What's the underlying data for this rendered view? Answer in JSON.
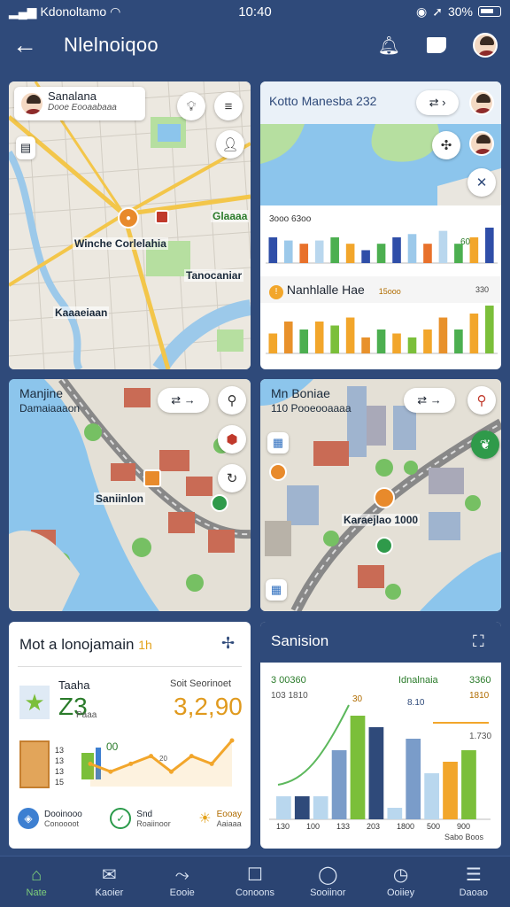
{
  "status": {
    "carrier": "Kdonoltamo",
    "time": "10:40",
    "battery": "30%"
  },
  "appbar": {
    "title": "Nlelnoiqoo"
  },
  "panel1": {
    "card_title": "Sanalana",
    "card_subtitle": "Dooe Eooaabaaa",
    "labels": {
      "center": "Winche Corlelahia",
      "east": "Tanocaniar",
      "southwest": "Kaaaeiaan",
      "northeast": "Glaaaa"
    }
  },
  "panel2": {
    "header": "Kotto Manesba 232",
    "chart1_title": "3ooo 63oo",
    "chart2_title": "Nanhlalle Hae",
    "chart2_badge": "15ooo",
    "chart2_value": "330",
    "chart1_label": "60",
    "chart_data": [
      {
        "type": "bar",
        "values": [
          8,
          7,
          6,
          7,
          8,
          6,
          4,
          6,
          8,
          9,
          6,
          10,
          6,
          8,
          11
        ]
      },
      {
        "type": "bar",
        "values": [
          5,
          8,
          6,
          8,
          7,
          9,
          4,
          6,
          5,
          4,
          6,
          9,
          6,
          10,
          12
        ]
      }
    ]
  },
  "panel3": {
    "title": "Manjine",
    "subtitle": "Damaiaaaon",
    "place": "Saniinlon"
  },
  "panel4": {
    "title": "Mn Boniae",
    "subtitle": "110 Pooeooaaaa",
    "place": "Karaejlao 1000"
  },
  "panel5": {
    "title": "Mot a lonojamain",
    "title_badge": "1h",
    "stat_label": "Taaha",
    "stat_sub": "Paaa",
    "stat_small": "Z3",
    "right_label": "Soit Seorinoet",
    "big_value": "3,2,90",
    "mini_value": "00",
    "chart_data": {
      "type": "line",
      "values": [
        6,
        5,
        6,
        7,
        5,
        7,
        6,
        9
      ]
    },
    "chart_labels": [
      "13",
      "13",
      "13",
      "15"
    ],
    "mid_label": "20",
    "footer": [
      {
        "label": "Dooinooo",
        "sub": "Conoooot"
      },
      {
        "label": "Snd",
        "sub": "Roaiinoor"
      },
      {
        "label": "Eooay",
        "sub": "Aaiaaa"
      }
    ]
  },
  "panel6": {
    "title": "Sanision",
    "left_top": "3 00360",
    "left_mid": "103 1810",
    "right_top": "Idnalnaia",
    "right_value": "3360",
    "right_mid": "1810",
    "bar_label": "30",
    "bar_label2": "8.10",
    "side_label": "1.730",
    "chart_data": {
      "type": "bar",
      "series": [
        {
          "values": [
            2,
            2,
            2,
            6,
            9,
            8,
            1,
            7,
            4,
            5,
            6
          ]
        }
      ]
    },
    "ticks": [
      "130",
      "100",
      "133",
      "203",
      "1800",
      "500",
      "900"
    ],
    "footer_right": "Sabo Boos"
  },
  "nav": [
    {
      "label": "Nate",
      "icon": "home-icon"
    },
    {
      "label": "Kaoier",
      "icon": "inbox-icon"
    },
    {
      "label": "Eooie",
      "icon": "route-icon"
    },
    {
      "label": "Conoons",
      "icon": "square-icon"
    },
    {
      "label": "Sooiinor",
      "icon": "chat-icon"
    },
    {
      "label": "Ooiiey",
      "icon": "timer-icon"
    },
    {
      "label": "Daoao",
      "icon": "menu-icon"
    }
  ],
  "colors": {
    "accent": "#7ed07a",
    "bg": "#2f4a7a",
    "water": "#8cc5ec"
  }
}
